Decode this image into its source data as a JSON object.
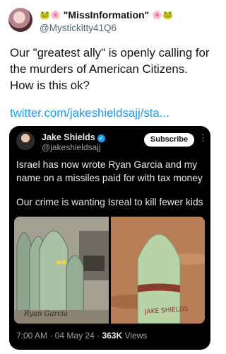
{
  "post": {
    "display_name": "\"MissInformation\"",
    "handle": "@Mystickitty41Q6",
    "body": "Our \"greatest ally\" is openly calling for the murders of American Citizens. How is this ok?",
    "link": "twitter.com/jakeshieldsajj/sta..."
  },
  "quote": {
    "name": "Jake Shields",
    "handle": "@jakeshieldsajj",
    "subscribe_label": "Subscribe",
    "text1": "Israel has now wrote Ryan Garcia and my name on a missiles paid for with tax money",
    "text2": "Our crime is wanting Isreal to kill fewer kids",
    "media_left_caption": "Ryan Garcia",
    "media_right_caption": "JAKE SHIELDS",
    "time": "7:00 AM",
    "date": "04 May 24",
    "views_count": "363K",
    "views_label": "Views"
  },
  "colors": {
    "link": "#1d9bf0",
    "verified": "#1d9bf0",
    "card_bg": "#000000"
  },
  "icons": [
    "frog-emoji-icon",
    "flower-emoji-icon",
    "verified-badge-icon",
    "more-options-icon"
  ]
}
